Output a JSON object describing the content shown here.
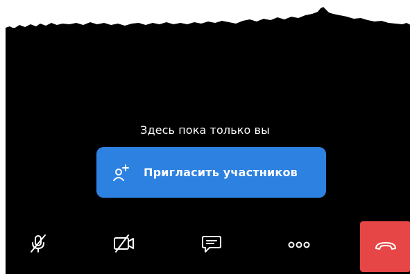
{
  "call": {
    "status_text": "Здесь пока только вы",
    "invite_label": "Пригласить участников"
  },
  "toolbar": {
    "items": [
      {
        "icon": "microphone-off-icon"
      },
      {
        "icon": "camera-off-icon"
      },
      {
        "icon": "chat-icon"
      },
      {
        "icon": "more-icon"
      },
      {
        "icon": "end-call-icon"
      }
    ]
  },
  "colors": {
    "background": "#000000",
    "accent": "#2d81e0",
    "end_call": "#e64646",
    "text": "#ffffff"
  }
}
